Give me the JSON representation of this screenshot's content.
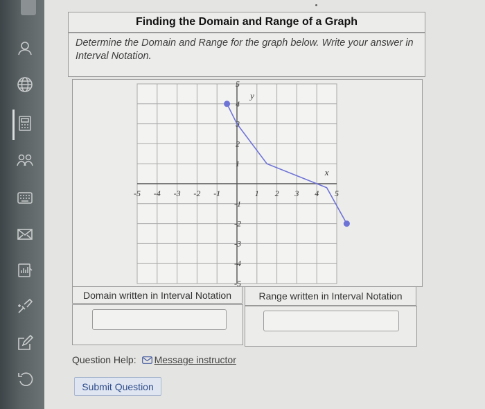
{
  "page": {
    "title": "Finding the Domain and Range of a Graph",
    "instructions": "Determine the Domain and Range for the graph below. Write your answer in Interval Notation."
  },
  "sidebar": {
    "items": [
      {
        "icon": "user-icon"
      },
      {
        "icon": "globe-icon"
      },
      {
        "icon": "calculator-icon"
      },
      {
        "icon": "people-icon"
      },
      {
        "icon": "keyboard-icon"
      },
      {
        "icon": "envelope-icon"
      },
      {
        "icon": "document-icon"
      },
      {
        "icon": "brush-icon"
      },
      {
        "icon": "edit-icon"
      },
      {
        "icon": "undo-icon"
      }
    ]
  },
  "answers": {
    "domain_label": "Domain written in Interval Notation",
    "range_label": "Range written in Interval Notation",
    "domain_value": "",
    "range_value": ""
  },
  "help": {
    "label": "Question Help:",
    "link": "Message instructor"
  },
  "submit_label": "Submit Question",
  "chart_data": {
    "type": "line",
    "xlabel": "x",
    "ylabel": "y",
    "xlim": [
      -5,
      5
    ],
    "ylim": [
      -5,
      5
    ],
    "x_ticks": [
      "-5",
      "-4",
      "-3",
      "-2",
      "-1",
      "1",
      "2",
      "3",
      "4",
      "5"
    ],
    "y_ticks": [
      "5",
      "4",
      "3",
      "2",
      "1",
      "-1",
      "-2",
      "-3",
      "-4",
      "-5"
    ],
    "grid": true,
    "series": [
      {
        "points": [
          [
            -0.5,
            4
          ],
          [
            0,
            3
          ],
          [
            1.5,
            1
          ],
          [
            4.5,
            -0.2
          ],
          [
            5.5,
            -2
          ]
        ],
        "closed_endpoints": [
          [
            -0.5,
            4
          ],
          [
            5.5,
            -2
          ]
        ],
        "color": "#6e73d6"
      }
    ]
  }
}
